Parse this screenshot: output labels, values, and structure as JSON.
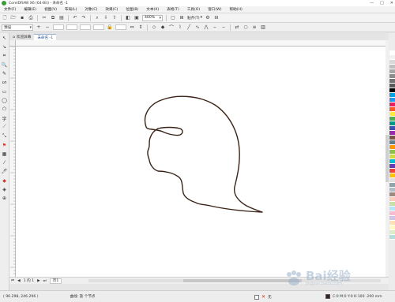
{
  "window": {
    "title": "CorelDRAW X6 (64-Bit) - 未命名 -1",
    "controls": [
      "—",
      "□",
      "✕"
    ]
  },
  "menu": {
    "items": [
      "文件(F)",
      "编辑(E)",
      "视图(V)",
      "布局(L)",
      "对象(C)",
      "效果(C)",
      "位图(B)",
      "文本(X)",
      "表格(T)",
      "工具(O)",
      "窗口(W)",
      "帮助(H)"
    ]
  },
  "toolbar": {
    "zoom_value": "400%",
    "snap_label": "贴齐(T)"
  },
  "propbar": {
    "preset_value": "预设"
  },
  "tabs": {
    "welcome_label": "欢迎屏幕",
    "doc_label": "未命名 -1"
  },
  "pagenav": {
    "page_count": "1 的 1",
    "page_tab_label": "页1"
  },
  "status": {
    "coords": "( 96.298, 246.296 )",
    "description": "曲线: 族 个节点",
    "fill_none": "无",
    "outline_info": "C:0 M:0 Y:0 K:100  .200 mm"
  },
  "watermark": {
    "text": "Bai经验",
    "sub": "jingyan.baidu.com"
  },
  "colors": {
    "outline": "#3a2418",
    "accent": "#1a4f9c"
  },
  "palette": [
    "#ffffff",
    "#f2f2f2",
    "#d9d9d9",
    "#bfbfbf",
    "#a6a6a6",
    "#8c8c8c",
    "#737373",
    "#595959",
    "#000000",
    "#00a2e8",
    "#2196f3",
    "#e91e63",
    "#ff5722",
    "#ffeb3b",
    "#4caf50",
    "#009688",
    "#3f51b5",
    "#9c27b0",
    "#795548",
    "#607d8b",
    "#ff9800",
    "#8bc34a",
    "#cddc39",
    "#00bcd4",
    "#673ab7",
    "#f44336",
    "#ffc107",
    "#e0e0e0",
    "#90a4ae",
    "#b0bec5",
    "#a1887f",
    "#ffccbc",
    "#c5e1a5",
    "#b3e5fc",
    "#f8bbd0",
    "#d1c4e9",
    "#ffe0b2",
    "#fff9c4",
    "#dcedc8",
    "#b2dfdb"
  ]
}
